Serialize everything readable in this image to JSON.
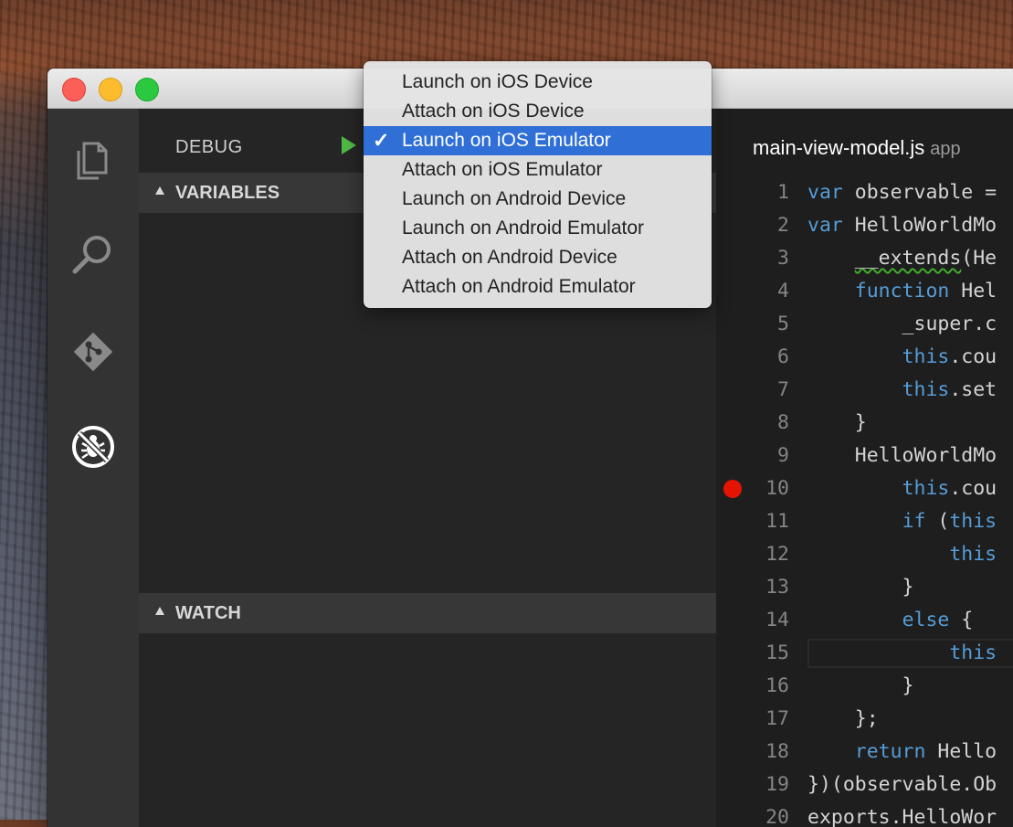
{
  "activity_bar": {
    "icons": [
      "files-icon",
      "search-icon",
      "git-icon",
      "debug-icon"
    ]
  },
  "debug": {
    "title": "DEBUG",
    "play_icon": "play-icon"
  },
  "sections": {
    "variables": "VARIABLES",
    "watch": "WATCH"
  },
  "launch_menu": {
    "selected_index": 2,
    "check_glyph": "✓",
    "items": [
      "Launch on iOS Device",
      "Attach on iOS Device",
      "Launch on iOS Emulator",
      "Attach on iOS Emulator",
      "Launch on Android Device",
      "Launch on Android Emulator",
      "Attach on Android Device",
      "Attach on Android Emulator"
    ]
  },
  "editor": {
    "filename": "main-view-model.js",
    "folder": "app",
    "breakpoint_line": 10,
    "lines": [
      {
        "n": "1",
        "code": "var observable ="
      },
      {
        "n": "2",
        "code": "var HelloWorldMo"
      },
      {
        "n": "3",
        "code": "    __extends(He"
      },
      {
        "n": "4",
        "code": "    function Hel"
      },
      {
        "n": "5",
        "code": "        _super.c"
      },
      {
        "n": "6",
        "code": "        this.cou"
      },
      {
        "n": "7",
        "code": "        this.set"
      },
      {
        "n": "8",
        "code": "    }"
      },
      {
        "n": "9",
        "code": "    HelloWorldMo"
      },
      {
        "n": "10",
        "code": "        this.cou"
      },
      {
        "n": "11",
        "code": "        if (this"
      },
      {
        "n": "12",
        "code": "            this"
      },
      {
        "n": "13",
        "code": "        }"
      },
      {
        "n": "14",
        "code": "        else {"
      },
      {
        "n": "15",
        "code": "            this"
      },
      {
        "n": "16",
        "code": "        }"
      },
      {
        "n": "17",
        "code": "    };"
      },
      {
        "n": "18",
        "code": "    return Hello"
      },
      {
        "n": "19",
        "code": "})(observable.Ob"
      },
      {
        "n": "20",
        "code": "exports.HelloWor"
      }
    ]
  }
}
